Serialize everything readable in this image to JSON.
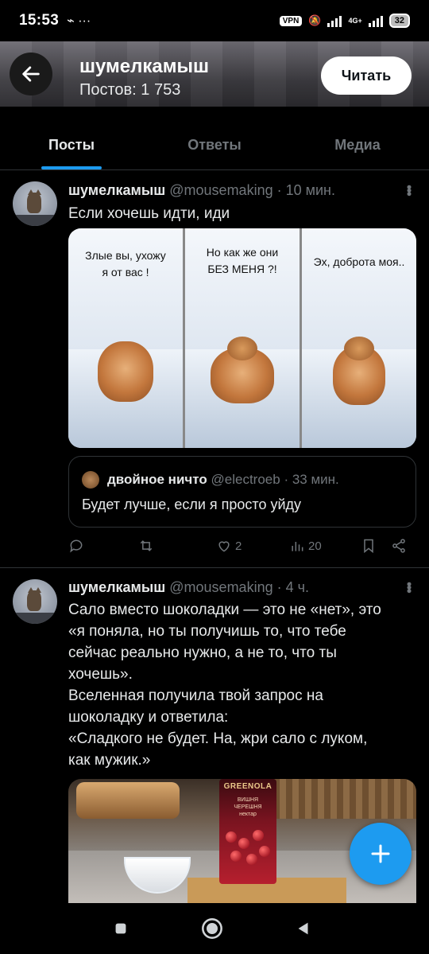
{
  "status_bar": {
    "time": "15:53",
    "notif_icons": "⌁ ···",
    "vpn": "VPN",
    "net": "4G+",
    "battery": "32"
  },
  "header": {
    "name": "шумелкамыш",
    "posts": "Постов: 1 753",
    "follow_label": "Читать"
  },
  "tabs": [
    {
      "label": "Посты",
      "active": true
    },
    {
      "label": "Ответы",
      "active": false
    },
    {
      "label": "Медиа",
      "active": false
    }
  ],
  "tweets": [
    {
      "name": "шумелкамыш",
      "handle": "@mousemaking",
      "time": "· 10 мин.",
      "text": "Если хочешь идти, иди",
      "meme_captions": [
        "Злые вы, ухожу\nя от вас !",
        "Но как же они\nБЕЗ МЕНЯ ?!",
        "Эх, доброта моя.."
      ],
      "quote": {
        "name": "двойное ничто",
        "handle": "@electroeb",
        "time": "· 33 мин.",
        "text": "Будет лучше, если я просто уйду"
      },
      "actions": {
        "likes": "2",
        "views": "20"
      }
    },
    {
      "name": "шумелкамыш",
      "handle": "@mousemaking",
      "time": "· 4 ч.",
      "text_lines": [
        "Сало вместо шоколадки — это не «нет», это",
        "«я поняла, но ты получишь то, что тебе",
        "сейчас реально нужно, а не то, что ты",
        "хочешь».",
        "Вселенная получила твой запрос на",
        "шоколадку и ответила:",
        "«Сладкого не будет. На, жри сало с луком,",
        "как мужик.»"
      ],
      "photo_brand": "GREENOLA",
      "photo_sub": "ВИШНЯ\nЧЕРЕШНЯ\nнектар"
    }
  ],
  "colors": {
    "accent": "#1d9bf0",
    "background": "#000000",
    "muted": "#71767b"
  }
}
